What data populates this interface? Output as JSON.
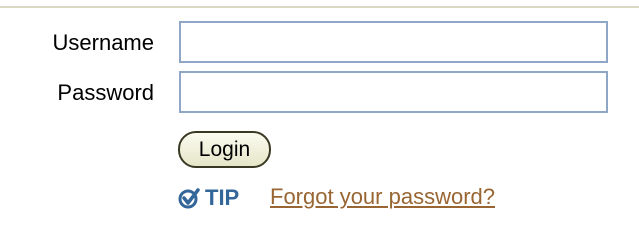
{
  "form": {
    "username_label": "Username",
    "username_value": "",
    "password_label": "Password",
    "password_value": "",
    "login_label": "Login"
  },
  "tip": {
    "label": "TIP",
    "link_text": "Forgot your password?",
    "icon": "check-circle-icon"
  },
  "colors": {
    "field_border": "#8fa6c6",
    "tip_color": "#336699",
    "link_color": "#996633"
  }
}
